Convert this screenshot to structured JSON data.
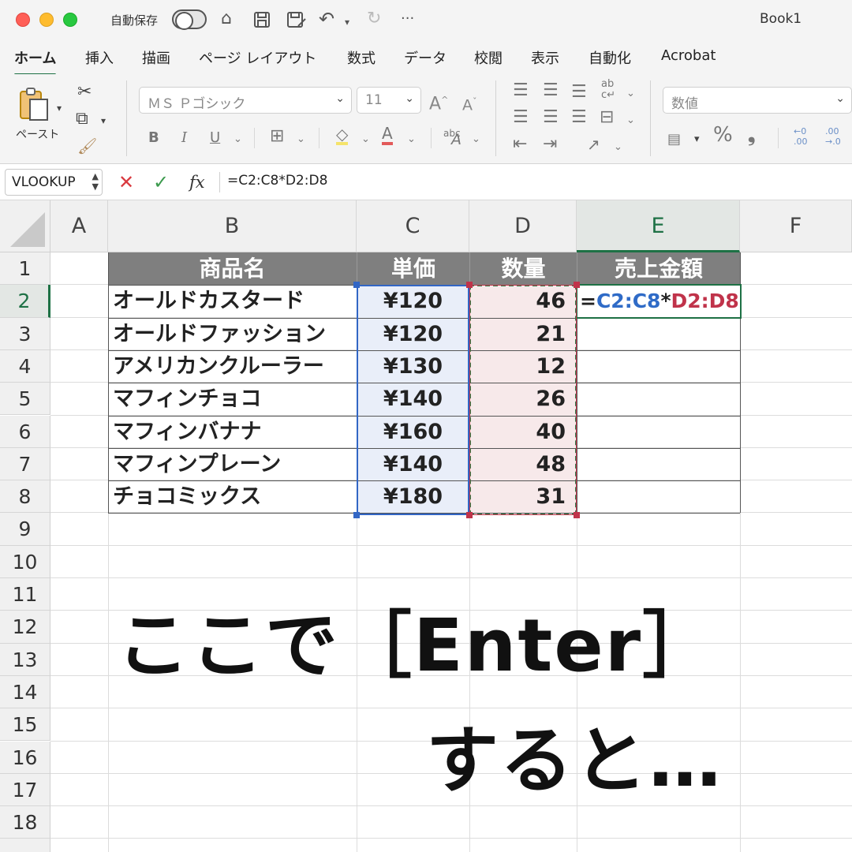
{
  "window": {
    "autosave_label": "自動保存",
    "title": "Book1",
    "more": "···"
  },
  "tabs": [
    "ホーム",
    "挿入",
    "描画",
    "ページ レイアウト",
    "数式",
    "データ",
    "校閲",
    "表示",
    "自動化",
    "Acrobat"
  ],
  "ribbon": {
    "paste_label": "ペースト",
    "font_name": "ＭＳ Ｐゴシック",
    "font_size": "11",
    "number_format": "数値",
    "bold": "B",
    "italic": "I",
    "underline": "U",
    "percent": "%",
    "comma": "❟"
  },
  "formula_bar": {
    "name_box": "VLOOKUP",
    "fx": "fx",
    "formula": "=C2:C8*D2:D8"
  },
  "sheet": {
    "columns": [
      "A",
      "B",
      "C",
      "D",
      "E",
      "F"
    ],
    "selected_column": "E",
    "rows": [
      "1",
      "2",
      "3",
      "4",
      "5",
      "6",
      "7",
      "8",
      "9",
      "10",
      "11",
      "12",
      "13",
      "14",
      "15",
      "16",
      "17",
      "18"
    ],
    "selected_row": "2",
    "header": [
      "商品名",
      "単価",
      "数量",
      "売上金額"
    ],
    "products": [
      {
        "name": "オールドカスタード",
        "price": "¥120",
        "qty": "46"
      },
      {
        "name": "オールドファッション",
        "price": "¥120",
        "qty": "21"
      },
      {
        "name": "アメリカンクルーラー",
        "price": "¥130",
        "qty": "12"
      },
      {
        "name": "マフィンチョコ",
        "price": "¥140",
        "qty": "26"
      },
      {
        "name": "マフィンバナナ",
        "price": "¥160",
        "qty": "40"
      },
      {
        "name": "マフィンプレーン",
        "price": "¥140",
        "qty": "48"
      },
      {
        "name": "チョコミックス",
        "price": "¥180",
        "qty": "31"
      }
    ],
    "editing_cell": {
      "eq": "=",
      "ref1": "C2:C8",
      "op": "*",
      "ref2": "D2:D8"
    }
  },
  "overlay": {
    "line1": "ここで［Enter］",
    "line2": "すると…"
  },
  "colors": {
    "accent": "#1e7145",
    "ref_blue": "#2f6bc7",
    "ref_red": "#c0334a"
  }
}
